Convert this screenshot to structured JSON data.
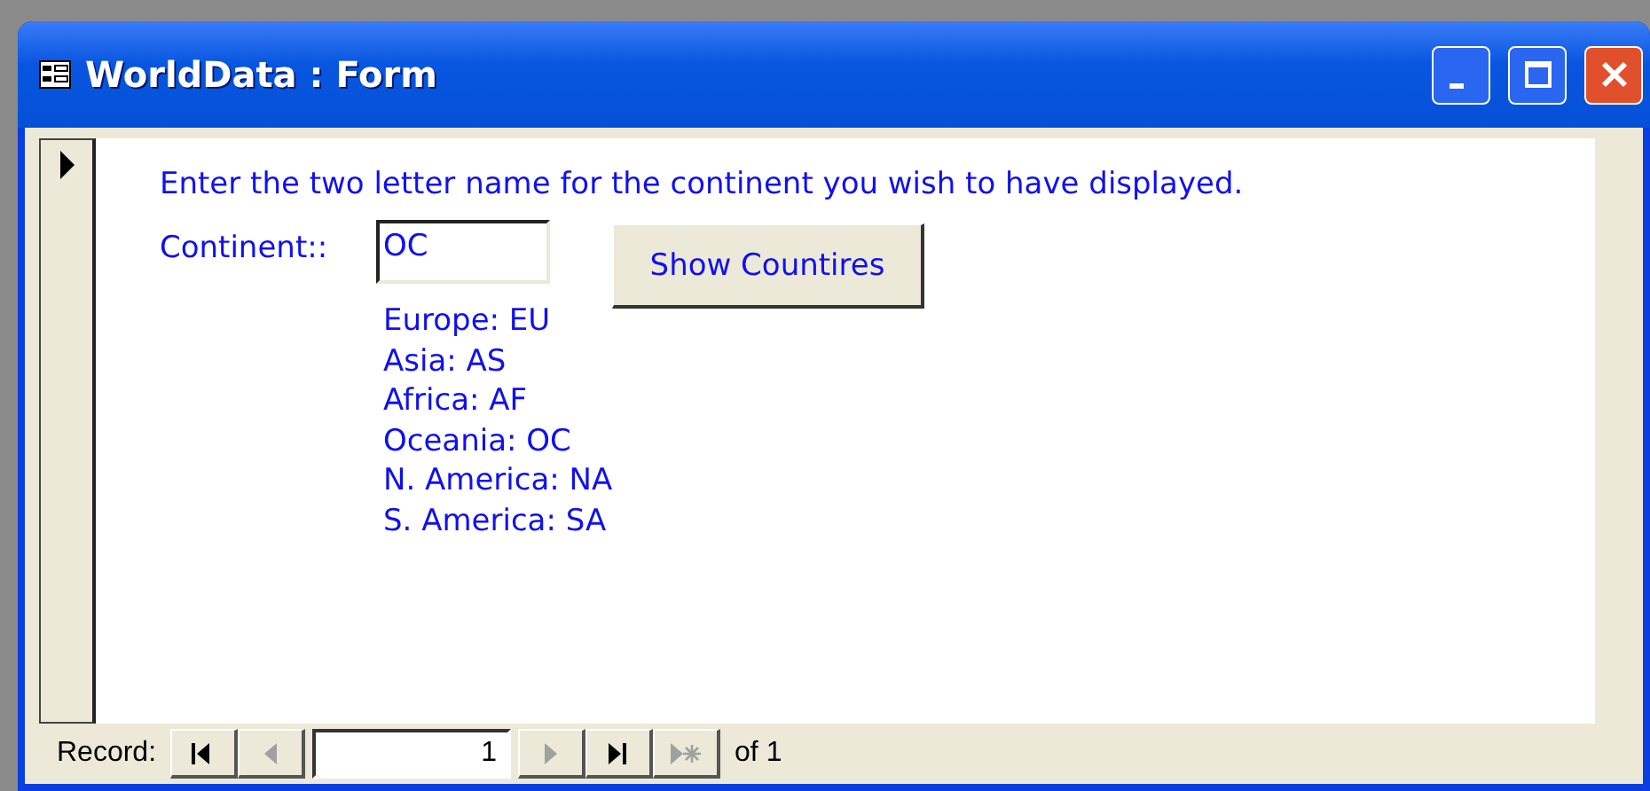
{
  "window": {
    "title": "WorldData : Form"
  },
  "form": {
    "instruction": "Enter the two letter name for the continent you wish to have displayed.",
    "continent_label": "Continent::",
    "continent_field": {
      "value": "OC"
    },
    "show_button": "Show Countires",
    "codes": [
      "Europe: EU",
      "Asia: AS",
      "Africa: AF",
      "Oceania: OC",
      "N. America: NA",
      "S. America: SA"
    ]
  },
  "navigation": {
    "label": "Record:",
    "record": "1",
    "count": "of 1",
    "buttons": [
      {
        "kind": "first",
        "disabled": false
      },
      {
        "kind": "previous",
        "disabled": true
      },
      {
        "kind": "next",
        "disabled": true
      },
      {
        "kind": "last",
        "disabled": false
      },
      {
        "kind": "new",
        "disabled": true
      }
    ]
  }
}
